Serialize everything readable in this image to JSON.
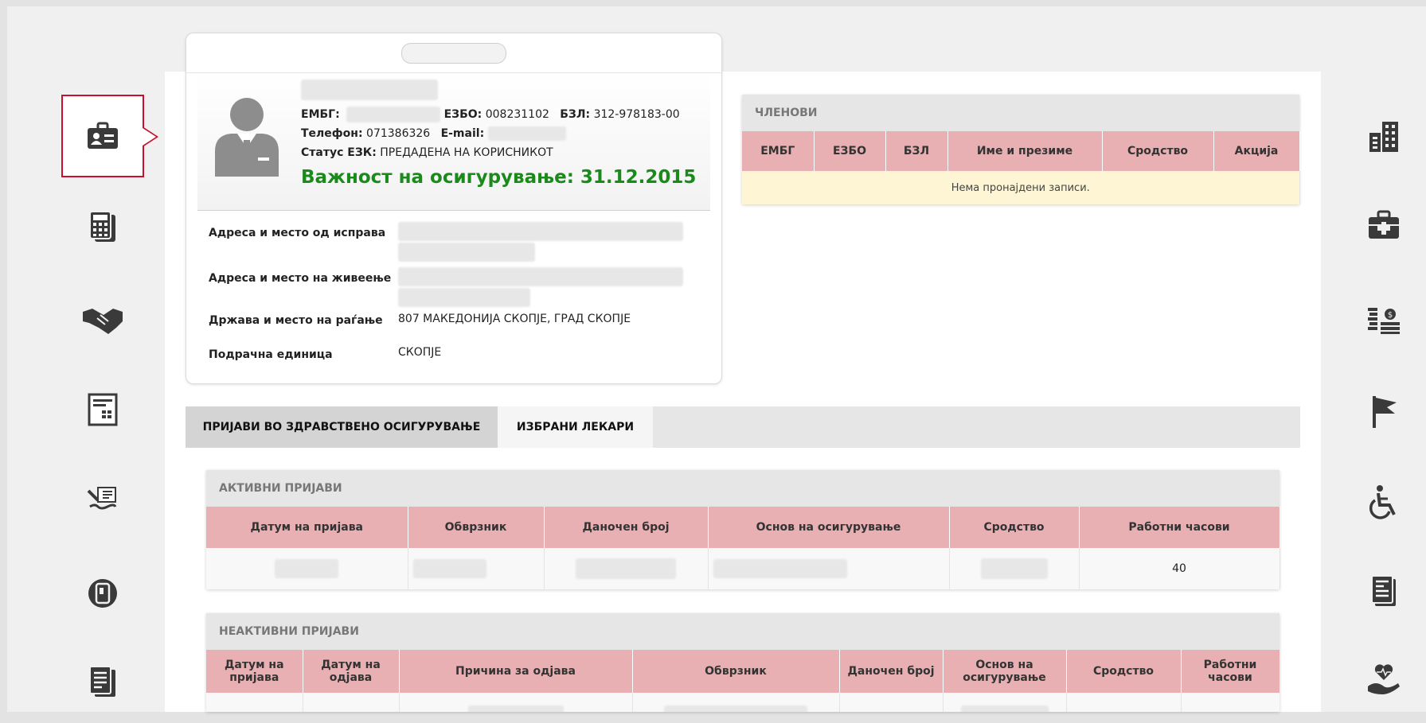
{
  "card": {
    "embg_label": "ЕМБГ:",
    "ezbo_label": "ЕЗБО:",
    "ezbo_value": "008231102",
    "bzl_label": "БЗЛ:",
    "bzl_value": "312-978183-00",
    "phone_label": "Телефон:",
    "phone_value": "071386326",
    "email_label": "E-mail:",
    "status_label": "Статус ЕЗК:",
    "status_value": "ПРЕДАДЕНА НА КОРИСНИКОТ",
    "validity": "Важност на осигурување: 31.12.2015",
    "rows": [
      {
        "label": "Адреса и место од исправа",
        "value": ""
      },
      {
        "label": "Адреса и место на живеење",
        "value": ""
      },
      {
        "label": "Држава и место на раѓање",
        "value": "807 МАКЕДОНИЈА СКОПЈЕ, ГРАД СКОПЈЕ"
      },
      {
        "label": "Подрачна единица",
        "value": "СКОПЈЕ"
      }
    ]
  },
  "members": {
    "title": "ЧЛЕНОВИ",
    "columns": [
      "ЕМБГ",
      "ЕЗБО",
      "БЗЛ",
      "Име и презиме",
      "Сродство",
      "Акција"
    ],
    "empty_message": "Нема пронајдени записи."
  },
  "tabs": [
    {
      "label": "ПРИЈАВИ ВО ЗДРАВСТВЕНО ОСИГУРУВАЊЕ",
      "active": true
    },
    {
      "label": "ИЗБРАНИ ЛЕКАРИ",
      "active": false
    }
  ],
  "active_registrations": {
    "title": "АКТИВНИ ПРИЈАВИ",
    "columns": [
      "Датум на пријава",
      "Обврзник",
      "Даночен број",
      "Основ на осигурување",
      "Сродство",
      "Работни часови"
    ],
    "rows": [
      {
        "work_hours": "40"
      }
    ]
  },
  "inactive_registrations": {
    "title": "НЕАКТИВНИ ПРИЈАВИ",
    "columns": [
      "Датум на пријава",
      "Датум на одјава",
      "Причина за одјава",
      "Обврзник",
      "Даночен број",
      "Основ на осигурување",
      "Сродство",
      "Работни часови"
    ]
  },
  "left_nav": [
    "id-card-icon",
    "calculator-icon",
    "handshake-icon",
    "form-icon",
    "signature-icon",
    "stamp-icon",
    "documents-icon"
  ],
  "right_nav": [
    "buildings-icon",
    "medical-kit-icon",
    "coins-icon",
    "flag-icon",
    "wheelchair-icon",
    "report-icon",
    "heart-hand-icon"
  ],
  "colors": {
    "accent_red": "#c8102e",
    "table_header": "#e8b0b3",
    "validity_green": "#1a8a1a",
    "empty_row": "#fdf5d4"
  }
}
